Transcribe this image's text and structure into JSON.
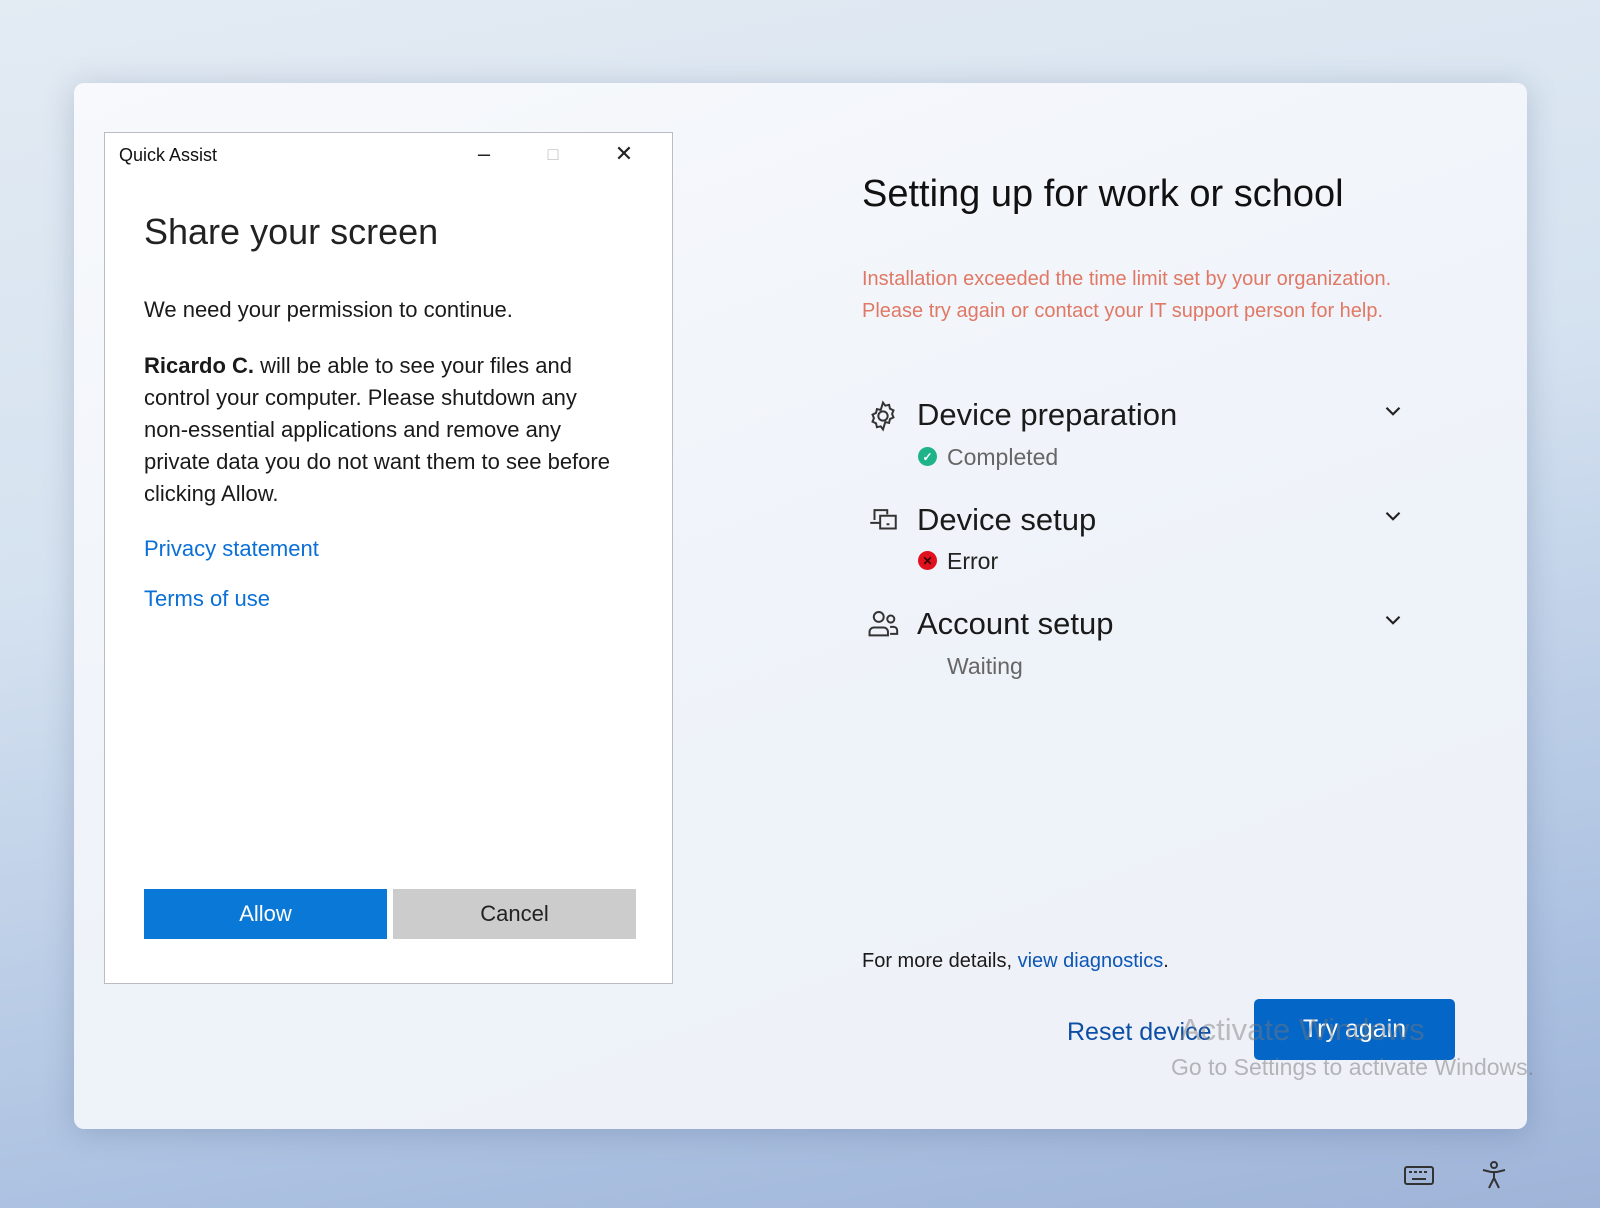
{
  "quick_assist": {
    "window_title": "Quick Assist",
    "heading": "Share your screen",
    "permission_text": "We need your permission to continue.",
    "helper_name": "Ricardo C.",
    "body_text": " will be able to see your files and control your computer. Please shutdown any non-essential applications and remove any private data you do not want them to see before clicking Allow.",
    "privacy_link": "Privacy statement",
    "terms_link": "Terms of use",
    "allow_label": "Allow",
    "cancel_label": "Cancel"
  },
  "setup": {
    "title": "Setting up for work or school",
    "error_line1": "Installation exceeded the time limit set by your organization.",
    "error_line2": "Please try again or contact your IT support person for help.",
    "steps": [
      {
        "title": "Device preparation",
        "status": "Completed",
        "icon": "gear-icon",
        "status_color": "#1fb38a"
      },
      {
        "title": "Device setup",
        "status": "Error",
        "icon": "devices-icon",
        "status_color": "#e0101e"
      },
      {
        "title": "Account setup",
        "status": "Waiting",
        "icon": "people-icon"
      }
    ],
    "details_prefix": "For more details, ",
    "details_link": "view diagnostics",
    "details_suffix": ".",
    "reset_label": "Reset device",
    "try_again_label": "Try again"
  },
  "watermark": {
    "line1": "Activate Windows",
    "line2": "Go to Settings to activate Windows."
  },
  "tray": {
    "icons": [
      "keyboard-icon",
      "accessibility-icon"
    ]
  }
}
